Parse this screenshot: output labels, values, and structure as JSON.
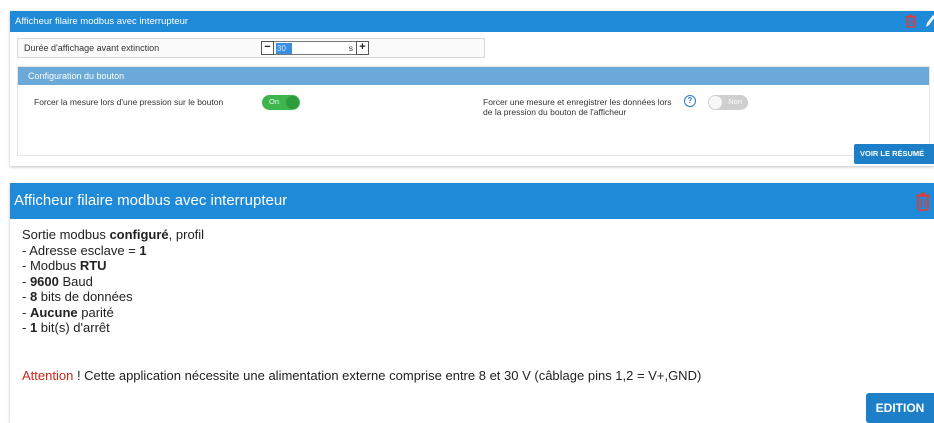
{
  "panel1": {
    "title": "Afficheur filaire modbus avec interrupteur",
    "duration": {
      "label": "Durée d'affichage avant extinction",
      "minus": "−",
      "value": "30",
      "unit": "s",
      "plus": "+"
    },
    "config": {
      "title": "Configuration du bouton",
      "force_label": "Forcer la mesure lors d'une pression sur le bouton",
      "force_toggle": "On",
      "force_record_label": "Forcer une mesure et enregistrer les données lors de la pression du bouton de l'afficheur",
      "help_glyph": "?",
      "force_record_toggle": "Non"
    },
    "resume_button": "VOIR LE RÉSUMÉ"
  },
  "panel2": {
    "title": "Afficheur filaire modbus avec interrupteur",
    "summary": {
      "l1_pre": "Sortie modbus ",
      "l1_bold": "configuré",
      "l1_post": ", profil",
      "l2_pre": "- Adresse esclave = ",
      "l2_bold": "1",
      "l3_pre": "- Modbus ",
      "l3_bold": "RTU",
      "l4_pre": "- ",
      "l4_bold": "9600",
      "l4_post": " Baud",
      "l5_pre": "- ",
      "l5_bold": "8",
      "l5_post": " bits de données",
      "l6_pre": "- ",
      "l6_bold": "Aucune",
      "l6_post": " parité",
      "l7_pre": "- ",
      "l7_bold": "1",
      "l7_post": " bit(s) d'arrêt"
    },
    "warning": {
      "prefix": "Attention",
      "text": " ! Cette application nécessite une alimentation externe comprise entre 8 et 30 V (câblage pins 1,2 = V+,GND)"
    },
    "edit_button": "EDITION"
  },
  "colors": {
    "header_blue": "#1f8ad8",
    "subheader_blue": "#6aa9d8",
    "button_blue": "#1c7fc8",
    "toggle_on": "#3fb54e",
    "toggle_off": "#cfcfcf",
    "trash_red": "#e53935",
    "warning_red": "#d0241a"
  },
  "icons": {
    "trash": "trash-icon",
    "edit": "pencil-icon",
    "help": "help-icon"
  }
}
